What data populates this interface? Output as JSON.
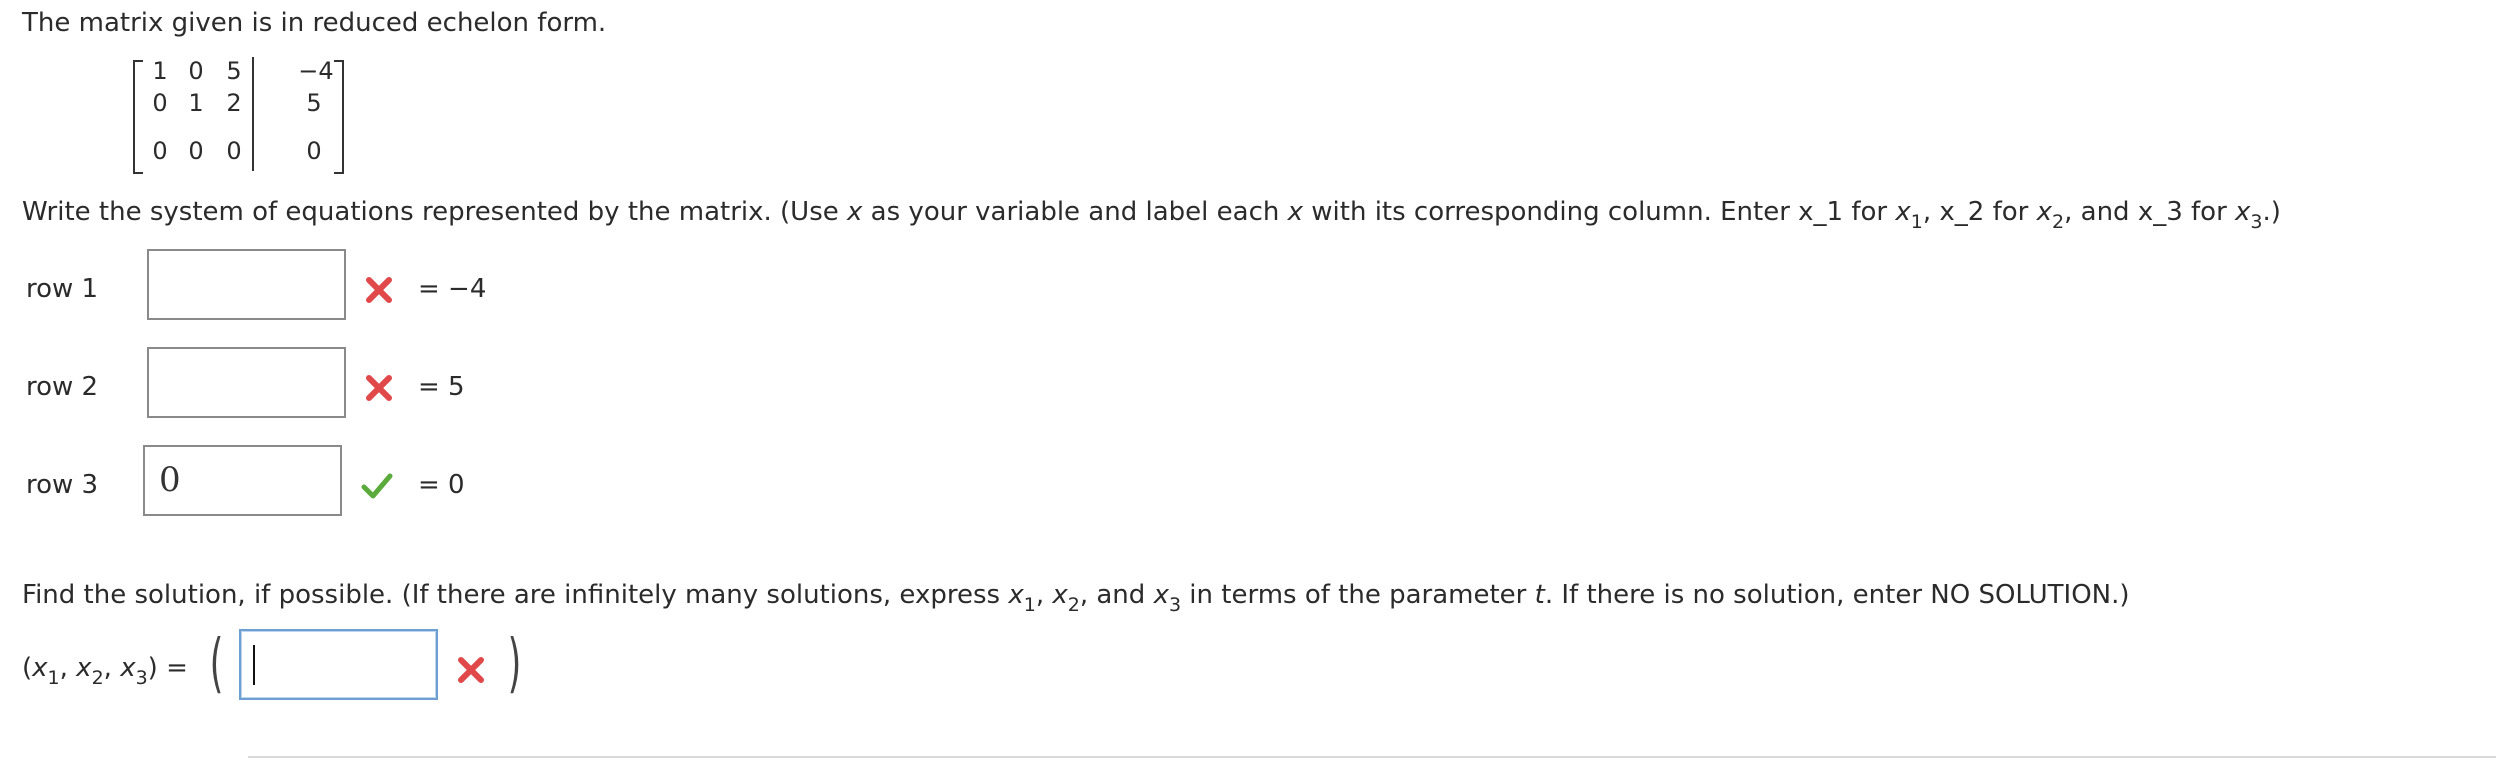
{
  "intro": "The matrix given is in reduced echelon form.",
  "matrix": {
    "rows": [
      [
        "1",
        "0",
        "5",
        "−4"
      ],
      [
        "0",
        "1",
        "2",
        "5"
      ],
      [
        "0",
        "0",
        "0",
        "0"
      ]
    ]
  },
  "instructions": {
    "part1": "Write the system of equations represented by the matrix. (Use ",
    "var1": "x",
    "part2": " as your variable and label each ",
    "var2": "x",
    "part3": " with its corresponding column. Enter x_1 for ",
    "x": "x",
    "s1": "1",
    "part4": ", x_2 for ",
    "s2": "2",
    "part5": ", and x_3 for ",
    "s3": "3",
    "part6": ".)"
  },
  "equations": [
    {
      "label": "row 1",
      "value": "",
      "status": "incorrect",
      "rhs": "= −4"
    },
    {
      "label": "row 2",
      "value": "",
      "status": "incorrect",
      "rhs": "= 5"
    },
    {
      "label": "row 3",
      "value": "0",
      "status": "correct",
      "rhs": "= 0"
    }
  ],
  "solution_prompt": {
    "part1": "Find the solution, if possible. (If there are infinitely many solutions, express ",
    "x": "x",
    "s1": "1",
    "sep1": ", ",
    "s2": "2",
    "sep2": ", and ",
    "s3": "3",
    "part2": " in terms of the parameter ",
    "param": "t",
    "part3": ". If there is no solution, enter NO SOLUTION.)"
  },
  "solution": {
    "open": "(",
    "x": "x",
    "s1": "1",
    "comma": ", ",
    "s2": "2",
    "s3": "3",
    "close_eq": ") =",
    "value": "",
    "status": "incorrect",
    "big_open": "(",
    "big_close": ")"
  },
  "colors": {
    "incorrect": "#e0484a",
    "correct": "#5aaa3c",
    "focus_border": "#6e9fd3"
  },
  "icons": {
    "incorrect": "x-mark-icon",
    "correct": "check-mark-icon"
  }
}
